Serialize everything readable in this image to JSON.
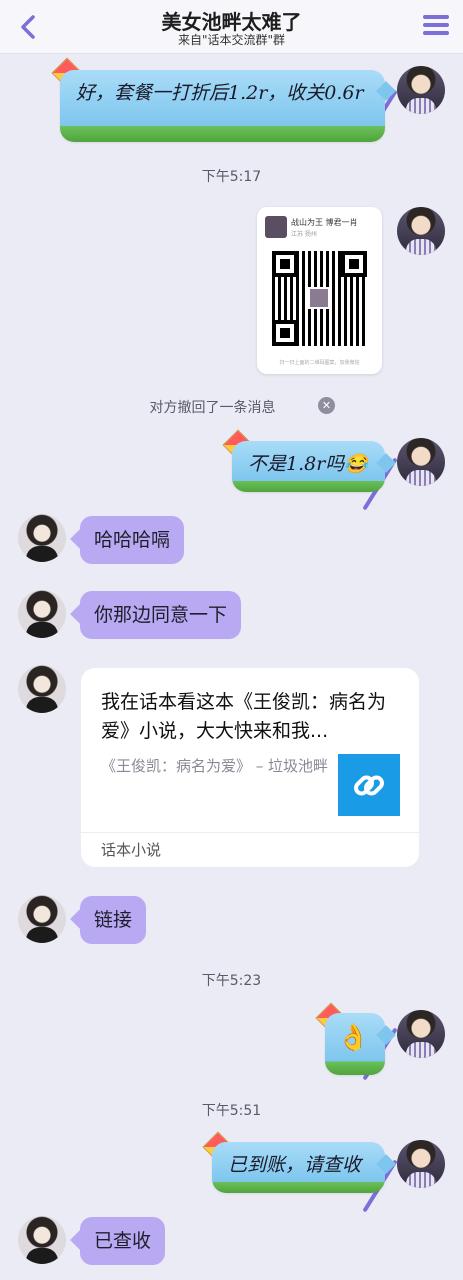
{
  "header": {
    "title": "美女池畔太难了",
    "subtitle": "来自\"话本交流群\"群"
  },
  "messages": {
    "m1": "好，套餐一打折后1.2r，收关0.6r",
    "t1": "下午5:17",
    "qr": {
      "name": "战山为王 博君一肖",
      "location": "江苏 扬州",
      "footer": "扫一扫上面的二维码图案，加我微信"
    },
    "recall": "对方撤回了一条消息",
    "m2": "不是1.8r吗😂",
    "m3": "哈哈哈嗝",
    "m4": "你那边同意一下",
    "share": {
      "title": "我在话本看这本《王俊凯：病名为爱》小说，大大快来和我...",
      "desc": "《王俊凯：病名为爱》 – 垃圾池畔",
      "source": "话本小说"
    },
    "m5": "链接",
    "t2": "下午5:23",
    "m6": "👌",
    "t3": "下午5:51",
    "m7": "已到账，请查收",
    "m8": "已查收"
  },
  "colors": {
    "accent": "#7b6fd8",
    "other_bubble": "#b8a9f2",
    "background": "#ebebf5",
    "link_box": "#1a9be6"
  }
}
